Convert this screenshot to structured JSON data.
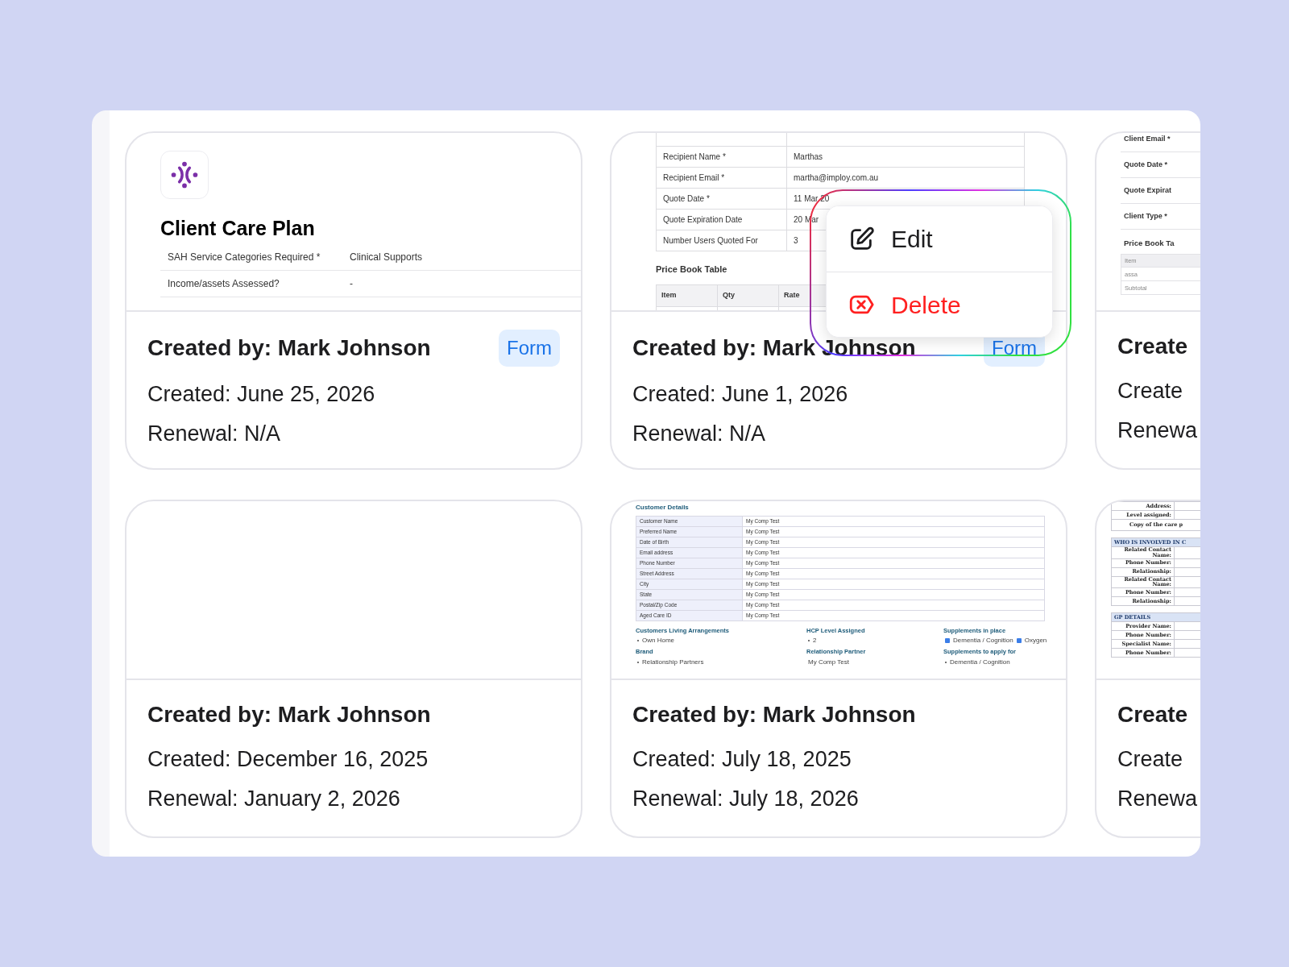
{
  "cards": [
    {
      "preview": {
        "kind": "care_plan_form",
        "title": "Client Care Plan",
        "rows": [
          {
            "label": "SAH Service Categories Required *",
            "value": "Clinical Supports"
          },
          {
            "label": "Income/assets Assessed?",
            "value": "-"
          }
        ]
      },
      "created_by": "Created by: Mark Johnson",
      "tag": "Form",
      "created": "Created: June 25, 2026",
      "renewal": "Renewal: N/A"
    },
    {
      "preview": {
        "kind": "quote",
        "rows": [
          {
            "label": "Recipient Name *",
            "value": "Marthas"
          },
          {
            "label": "Recipient Email *",
            "value": "martha@imploy.com.au"
          },
          {
            "label": "Quote Date *",
            "value": "11 Mar 20"
          },
          {
            "label": "Quote Expiration Date",
            "value": "20 Mar"
          },
          {
            "label": "Number Users Quoted For",
            "value": "3"
          }
        ],
        "section": "Price Book Table",
        "columns": [
          "Item",
          "Qty",
          "Rate"
        ]
      },
      "created_by": "Created by: Mark Johnson",
      "tag": "Form",
      "created": "Created: June 1, 2026",
      "renewal": "Renewal: N/A",
      "menu": {
        "items": [
          {
            "kind": "edit",
            "label": "Edit"
          },
          {
            "kind": "delete",
            "label": "Delete"
          }
        ]
      }
    },
    {
      "preview": {
        "kind": "quote_summary",
        "rows": [
          "Client Email *",
          "Quote Date *",
          "Quote Expirat",
          "Client Type *"
        ],
        "section": "Price Book Ta",
        "table_rows": [
          {
            "text": "Item",
            "header": true
          },
          {
            "text": "assa",
            "header": false
          },
          {
            "text": "Subtotal",
            "header": false
          }
        ]
      },
      "created_by": "Create",
      "created": "Create",
      "renewal": "Renewa"
    },
    {
      "preview": {
        "kind": "blank"
      },
      "created_by": "Created by: Mark Johnson",
      "created": "Created: December 16, 2025",
      "renewal": "Renewal: January 2, 2026"
    },
    {
      "preview": {
        "kind": "customer_details",
        "heading": "Customer Details",
        "rows": [
          {
            "label": "Customer Name",
            "value": "My Comp Test"
          },
          {
            "label": "Preferred Name",
            "value": "My Comp Test"
          },
          {
            "label": "Date of Birth",
            "value": "My Comp Test"
          },
          {
            "label": "Email address",
            "value": "My Comp Test"
          },
          {
            "label": "Phone Number",
            "value": "My Comp Test"
          },
          {
            "label": "Street Address",
            "value": "My Comp Test"
          },
          {
            "label": "City",
            "value": "My Comp Test"
          },
          {
            "label": "State",
            "value": "My Comp Test"
          },
          {
            "label": "Postal/Zip Code",
            "value": "My Comp Test"
          },
          {
            "label": "Aged Care ID",
            "value": "My Comp Test"
          }
        ],
        "columns": [
          [
            {
              "title": "Customers Living Arrangements",
              "bullets": [
                "Own Home"
              ]
            },
            {
              "title": "Brand",
              "bullets": [
                "Relationship Partners"
              ]
            }
          ],
          [
            {
              "title": "HCP Level Assigned",
              "bullets": [
                "2"
              ]
            },
            {
              "title": "Relationship Partner",
              "text": "My Comp Test"
            }
          ],
          [
            {
              "title": "Supplements in place",
              "checks": [
                {
                  "label": "Dementia / Cognition",
                  "checked": true
                },
                {
                  "label": "Oxygen",
                  "checked": true
                }
              ]
            },
            {
              "title": "Supplements to apply for",
              "bullets": [
                "Dementia / Cognition"
              ]
            }
          ]
        ]
      },
      "created_by": "Created by: Mark Johnson",
      "created": "Created: July 18, 2025",
      "renewal": "Renewal: July 18, 2026"
    },
    {
      "preview": {
        "kind": "care_plan",
        "rows": [
          {
            "kind": "row",
            "text": "Address:"
          },
          {
            "kind": "row",
            "text": "Level assigned:"
          },
          {
            "kind": "note",
            "text": "Copy of the care p"
          },
          {
            "kind": "header",
            "text": "WHO IS INVOLVED IN C"
          },
          {
            "kind": "row",
            "text": "Related Contact Name:"
          },
          {
            "kind": "row",
            "text": "Phone Number:"
          },
          {
            "kind": "row",
            "text": "Relationship:"
          },
          {
            "kind": "row",
            "text": "Related Contact Name:"
          },
          {
            "kind": "row",
            "text": "Phone Number:"
          },
          {
            "kind": "row",
            "text": "Relationship:"
          },
          {
            "kind": "header",
            "text": "GP DETAILS"
          },
          {
            "kind": "row",
            "text": "Provider Name:"
          },
          {
            "kind": "row",
            "text": "Phone Number:"
          },
          {
            "kind": "row",
            "text": "Specialist Name:"
          },
          {
            "kind": "row",
            "text": "Phone Number:"
          }
        ]
      },
      "created_by": "Create",
      "created": "Create",
      "renewal": "Renewa"
    }
  ]
}
